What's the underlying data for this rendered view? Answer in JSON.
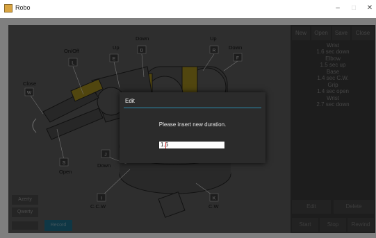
{
  "window": {
    "title": "Robo",
    "minimize": "–",
    "maximize": "□",
    "close": "✕"
  },
  "toolbar": {
    "new": "New",
    "open": "Open",
    "save": "Save",
    "close": "Close"
  },
  "sequence": [
    {
      "line1": "Wrist",
      "line2": "1.6 sec down"
    },
    {
      "line1": "Elbow",
      "line2": "1.5 sec up"
    },
    {
      "line1": "Base",
      "line2": "1.4 sec C.W."
    },
    {
      "line1": "Grip",
      "line2": "1.4 sec open"
    },
    {
      "line1": "Wrist",
      "line2": "2.7 sec down"
    }
  ],
  "controls": {
    "edit": "Edit",
    "delete": "Delete",
    "start": "Start",
    "stop": "Stop",
    "rewind": "Rewind"
  },
  "layout_buttons": {
    "azerty": "Azerty",
    "qwerty": "Qwerty",
    "record": "Record"
  },
  "robot_labels": {
    "close": "Close",
    "key_w": "W",
    "onoff": "On/Off",
    "key_l": "L",
    "up1": "Up",
    "key_e": "E",
    "down1": "Down",
    "key_d": "D",
    "up2": "Up",
    "key_r": "R",
    "down2": "Down",
    "key_f": "F",
    "key_s": "S",
    "open": "Open",
    "key_j": "J",
    "down3": "Down",
    "key_i": "I",
    "ccw": "C.C.W",
    "key_k": "K",
    "cw": "C.W"
  },
  "dialog": {
    "title": "Edit",
    "message": "Please insert new duration.",
    "value": "1.6"
  },
  "colors": {
    "accent": "#2c8fb2",
    "gripper_yellow": "#d6b317",
    "record_button": "#1f6f8a"
  }
}
